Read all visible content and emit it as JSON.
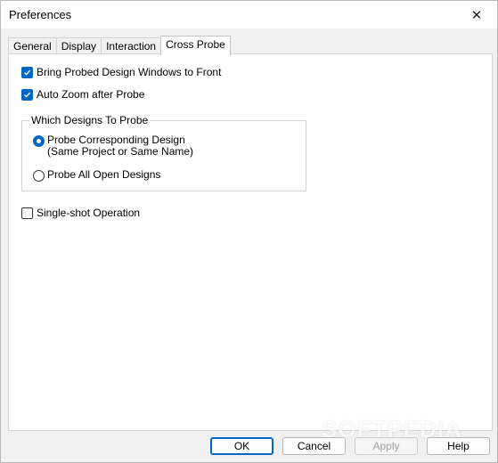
{
  "window": {
    "title": "Preferences",
    "close_glyph": "✕"
  },
  "tabs": [
    {
      "label": "General",
      "active": false
    },
    {
      "label": "Display",
      "active": false
    },
    {
      "label": "Interaction",
      "active": false
    },
    {
      "label": "Cross Probe",
      "active": true
    }
  ],
  "options": {
    "bring_to_front": {
      "label": "Bring Probed Design Windows to Front",
      "checked": true
    },
    "auto_zoom": {
      "label": "Auto Zoom after Probe",
      "checked": true
    },
    "single_shot": {
      "label": "Single-shot Operation",
      "checked": false
    }
  },
  "group": {
    "title": "Which Designs To Probe",
    "radio_corresponding": {
      "line1": "Probe Corresponding Design",
      "line2": "(Same Project or Same Name)",
      "selected": true
    },
    "radio_all_open": {
      "label": "Probe All Open Designs",
      "selected": false
    }
  },
  "buttons": {
    "ok": "OK",
    "cancel": "Cancel",
    "apply": "Apply",
    "help": "Help"
  },
  "watermark": "SOFTPEDIA",
  "colors": {
    "accent": "#0067c0"
  }
}
